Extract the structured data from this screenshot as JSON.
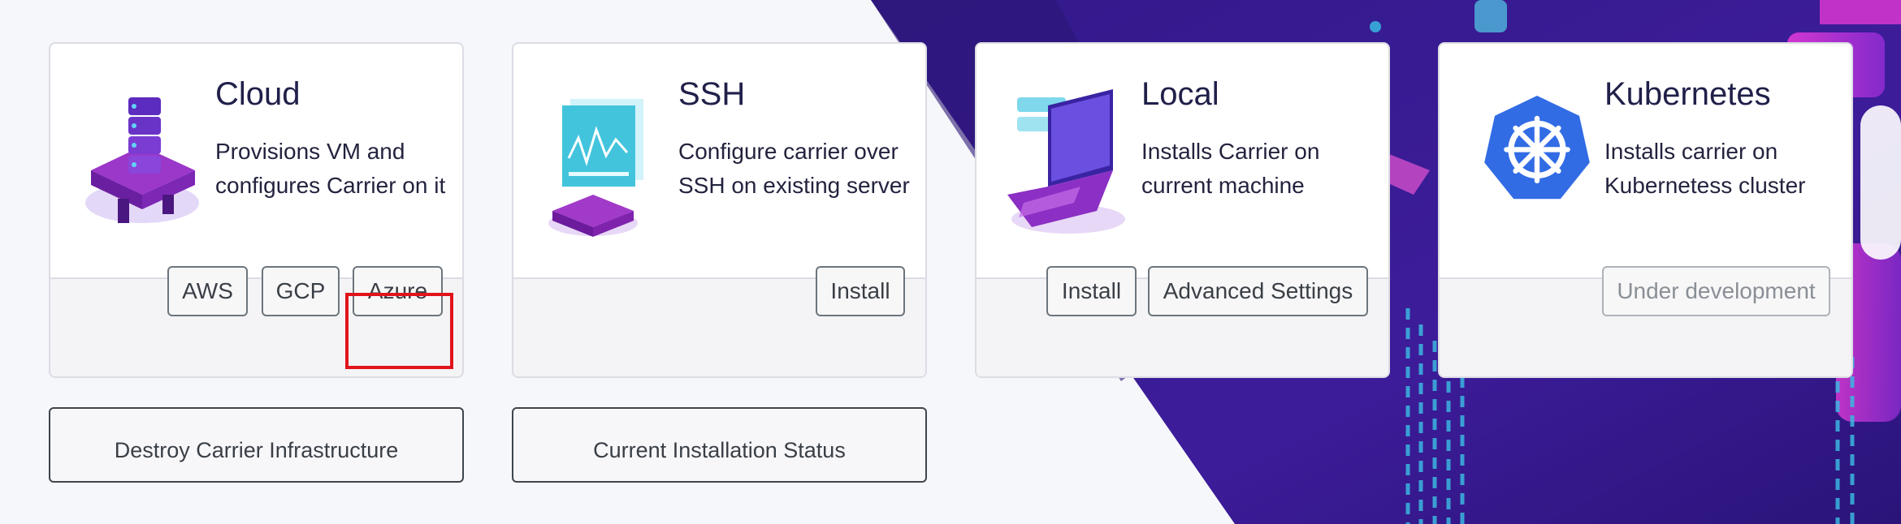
{
  "cards": [
    {
      "title": "Cloud",
      "description": "Provisions VM and configures Carrier on it",
      "buttons": [
        "AWS",
        "GCP",
        "Azure"
      ]
    },
    {
      "title": "SSH",
      "description": "Configure carrier over SSH on existing server",
      "buttons": [
        "Install"
      ]
    },
    {
      "title": "Local",
      "description": "Installs Carrier on current machine",
      "buttons": [
        "Install",
        "Advanced Settings"
      ]
    },
    {
      "title": "Kubernetes",
      "description": "Installs carrier on Kubernetess cluster",
      "buttons": [
        "Under development"
      ]
    }
  ],
  "actions": {
    "destroy_label": "Destroy Carrier Infrastructure",
    "status_label": "Current Installation Status"
  },
  "colors": {
    "background_purple": "#3a1c94",
    "accent_magenta": "#d02fbf",
    "kubernetes_blue": "#326ce5",
    "highlight_red": "#e1141b"
  },
  "icons": [
    "server-stack-icon",
    "ssh-terminal-icon",
    "laptop-icon",
    "kubernetes-helm-icon"
  ]
}
